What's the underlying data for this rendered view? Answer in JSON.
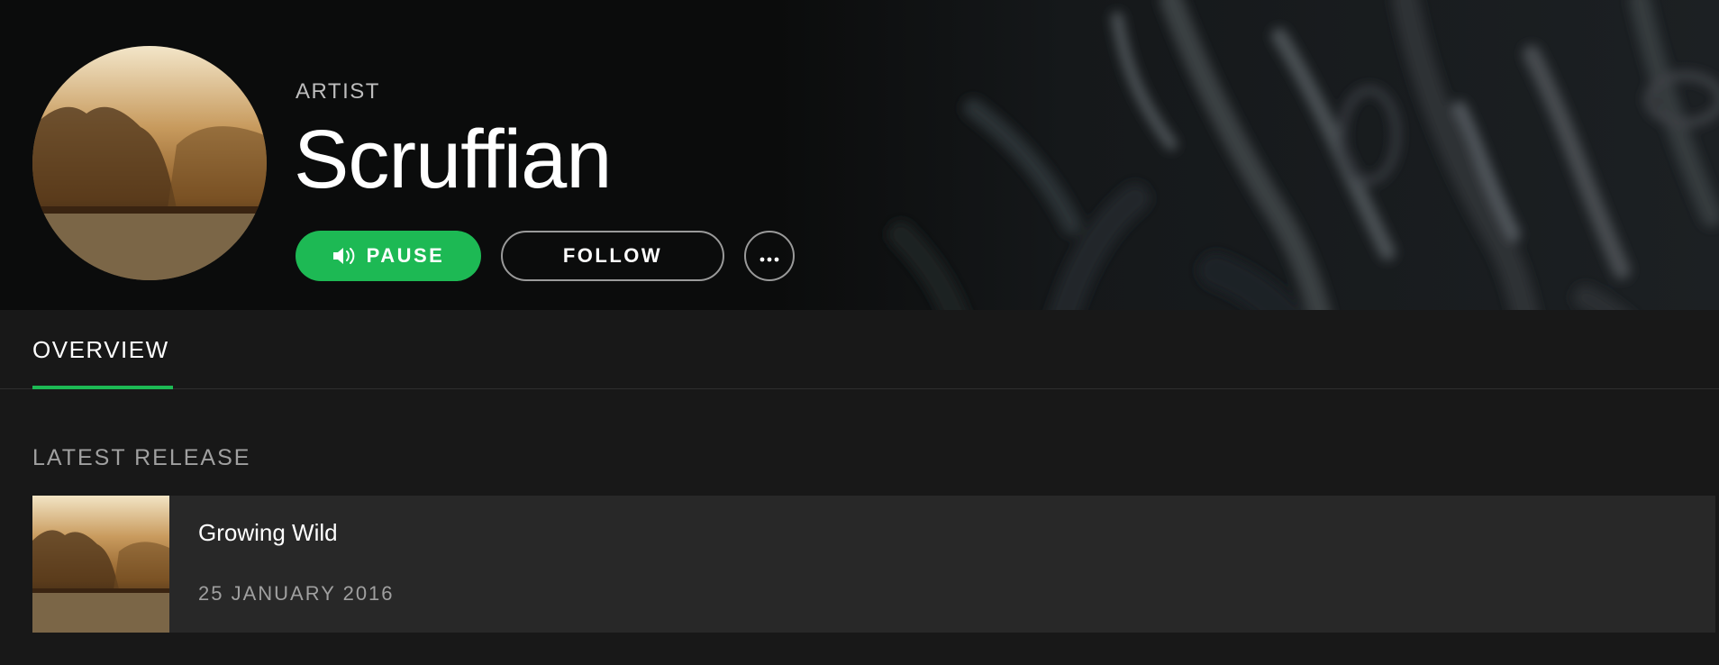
{
  "header": {
    "type_label": "ARTIST",
    "artist_name": "Scruffian",
    "background_color": "#0b0c0c"
  },
  "actions": {
    "pause_label": "PAUSE",
    "pause_icon": "volume-icon",
    "follow_label": "FOLLOW",
    "more_icon": "more-options-icon",
    "accent_color": "#1db954"
  },
  "tabs": [
    {
      "label": "OVERVIEW",
      "active": true
    }
  ],
  "latest_release": {
    "section_title": "LATEST RELEASE",
    "title": "Growing Wild",
    "date": "25 JANUARY 2016"
  }
}
